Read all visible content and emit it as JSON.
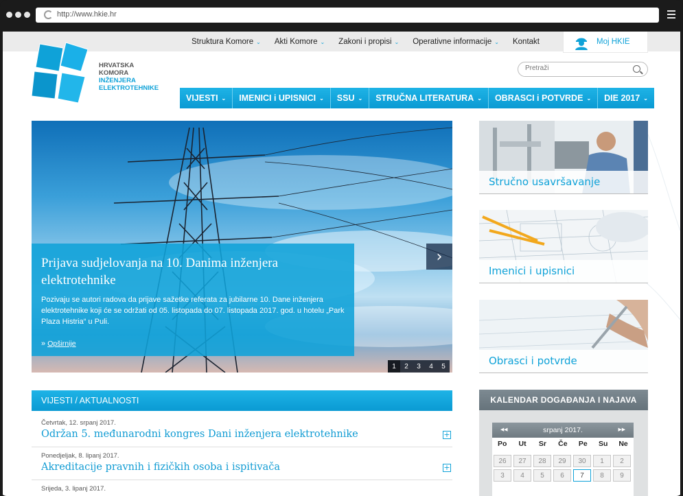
{
  "browser": {
    "url": "http://www.hkie.hr"
  },
  "logo": {
    "line1": "HRVATSKA",
    "line2": "KOMORA",
    "line3": "INŽENJERA",
    "line4": "ELEKTROTEHNIKE"
  },
  "topnav": {
    "items": [
      {
        "label": "Struktura Komore",
        "caret": "⌄"
      },
      {
        "label": "Akti Komore",
        "caret": "⌄"
      },
      {
        "label": "Zakoni i propisi",
        "caret": "⌄"
      },
      {
        "label": "Operativne informacije",
        "caret": "⌄"
      },
      {
        "label": "Kontakt",
        "caret": ""
      }
    ],
    "moj": "Moj HKIE"
  },
  "search": {
    "placeholder": "Pretraži"
  },
  "mainnav": [
    {
      "label": "VIJESTI"
    },
    {
      "label": "IMENICI i UPISNICI"
    },
    {
      "label": "SSU"
    },
    {
      "label": "STRUČNA LITERATURA"
    },
    {
      "label": "OBRASCI i POTVRDE"
    },
    {
      "label": "DIE 2017"
    }
  ],
  "slider": {
    "title": "Prijava sudjelovanja na 10. Danima inženjera elektrotehnike",
    "text": "Pozivaju se autori radova da prijave sažetke referata za jubilarne 10. Dane inženjera elektrotehnike koji će se održati od 05. listopada do 07. listopada 2017. god. u hotelu „Park Plaza Histria“ u Puli.",
    "more": "Opširnije",
    "pages": [
      "1",
      "2",
      "3",
      "4",
      "5"
    ],
    "active_page": "1"
  },
  "tiles": [
    {
      "label": "Stručno usavršavanje"
    },
    {
      "label": "Imenici i upisnici"
    },
    {
      "label": "Obrasci i potvrde"
    }
  ],
  "news": {
    "heading": "VIJESTI / AKTUALNOSTI",
    "items": [
      {
        "date": "Četvrtak, 12. srpanj 2017.",
        "title": "Održan 5. međunarodni kongres Dani inženjera elektrotehnike"
      },
      {
        "date": "Ponedjeljak, 8. lipanj 2017.",
        "title": "Akreditacije pravnih i fizičkih osoba i ispitivača"
      },
      {
        "date": "Srijeda, 3. lipanj 2017.",
        "title": ""
      }
    ]
  },
  "calendar": {
    "heading": "KALENDAR DOGAĐANJA I NAJAVA",
    "month": "srpanj 2017.",
    "days": [
      "Po",
      "Ut",
      "Sr",
      "Če",
      "Pe",
      "Su",
      "Ne"
    ],
    "cells": [
      "26",
      "27",
      "28",
      "29",
      "30",
      "1",
      "2",
      "3",
      "4",
      "5",
      "6",
      "7",
      "8",
      "9"
    ],
    "today": "7"
  },
  "colors": {
    "accent": "#0fa2d8",
    "calendar_header": "#6f7a81"
  }
}
